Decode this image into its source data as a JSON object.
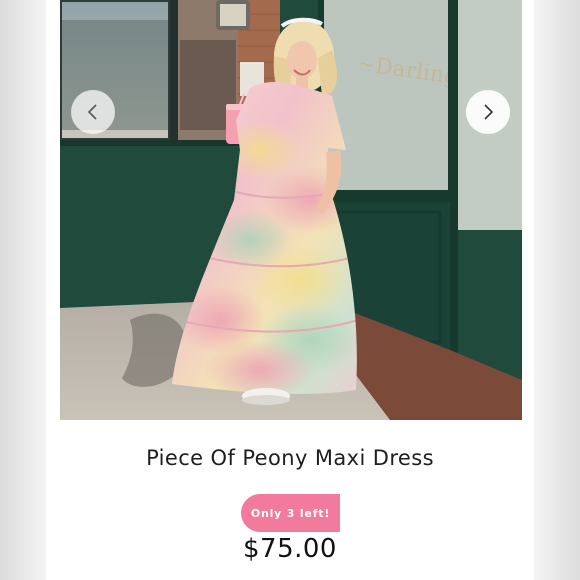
{
  "product": {
    "title": "Piece Of Peony Maxi Dress",
    "badge": "Only 3 left!",
    "price": "$75.00"
  },
  "gallery": {
    "prev_icon": "chevron-left-icon",
    "next_icon": "chevron-right-icon"
  },
  "colors": {
    "badge": "#f27a9c",
    "storefront_green": "#1f4a3c",
    "brick": "#a46a4e",
    "dress_pink": "#f4c9cf"
  }
}
